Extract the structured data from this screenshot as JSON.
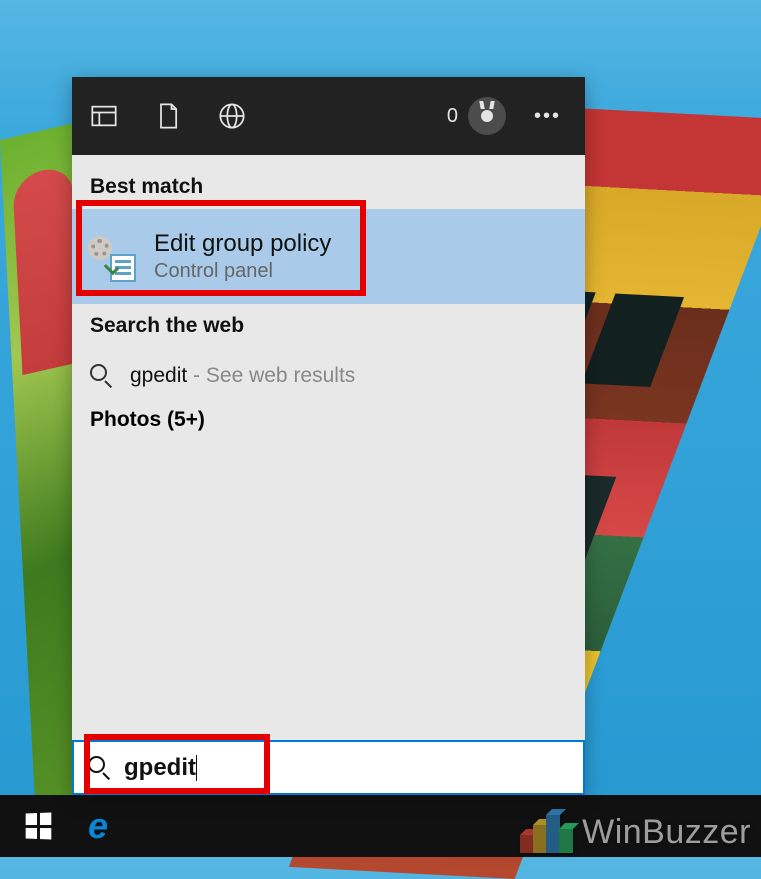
{
  "header": {
    "score": "0"
  },
  "results": {
    "best_match_label": "Best match",
    "item": {
      "title": "Edit group policy",
      "subtitle": "Control panel"
    },
    "web_label": "Search the web",
    "web_item": {
      "term": "gpedit",
      "suffix": " - See web results"
    },
    "photos_label": "Photos (5+)"
  },
  "search": {
    "value": "gpedit"
  },
  "watermark": {
    "text": "WinBuzzer"
  }
}
